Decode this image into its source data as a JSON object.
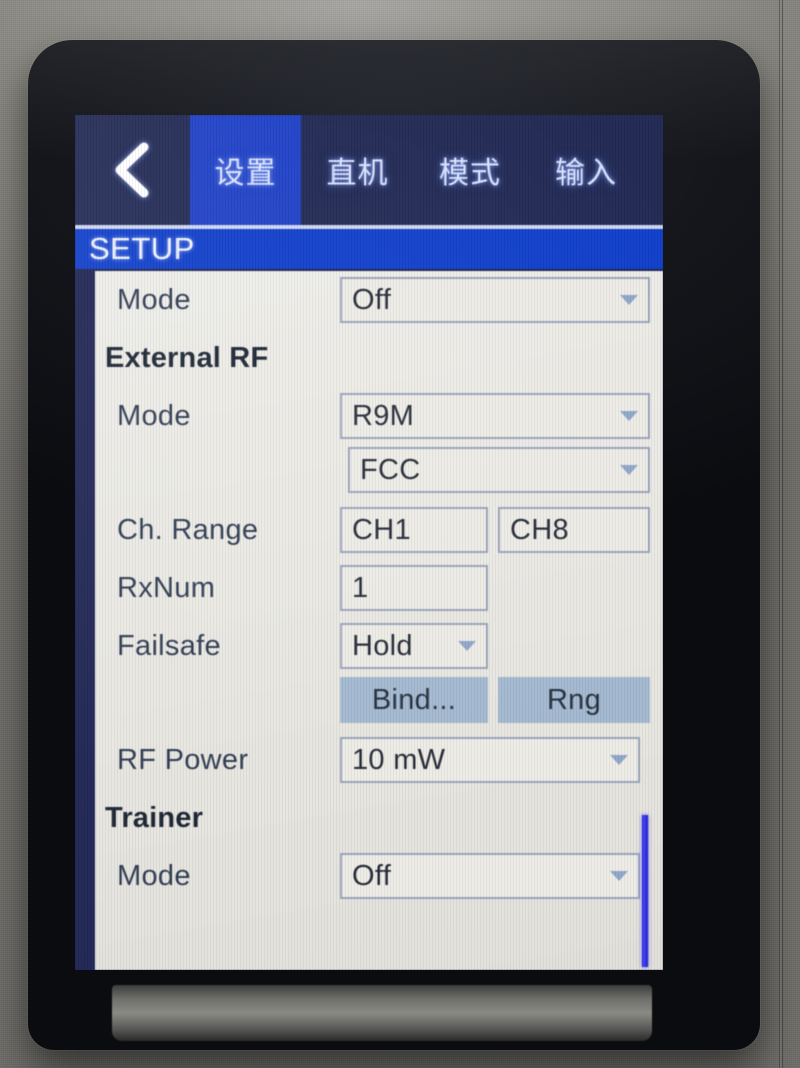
{
  "device": {
    "type": "rc-transmitter-lcd",
    "bezel_color": "#15171c",
    "background_color": "#87867f"
  },
  "screen": {
    "navbar": {
      "back_icon": "chevron-left-icon",
      "background_color": "#222a55",
      "active_tab_color": "#1f41c8",
      "tabs": [
        {
          "label": "设置",
          "active": true
        },
        {
          "label": "直机",
          "active": false
        },
        {
          "label": "模式",
          "active": false
        },
        {
          "label": "输入",
          "active": false
        }
      ]
    },
    "header": {
      "title": "SETUP",
      "background_color": "#0f3ecb",
      "text_color": "#f2f5ff"
    },
    "form": {
      "rows": [
        {
          "id": "internal-rf-mode",
          "label": "Mode",
          "type": "field",
          "section": false,
          "value": "Off",
          "dropdown": true
        },
        {
          "id": "external-rf-header",
          "label": "External RF",
          "type": "section",
          "section": true
        },
        {
          "id": "external-rf-mode",
          "label": "Mode",
          "type": "field",
          "section": false,
          "value": "R9M",
          "dropdown": true
        },
        {
          "id": "external-rf-region",
          "label": "",
          "type": "field",
          "section": false,
          "value": "FCC",
          "dropdown": true
        },
        {
          "id": "channel-range",
          "label": "Ch. Range",
          "type": "field-pair",
          "section": false,
          "value": "CH1",
          "value2": "CH8",
          "dropdown": false
        },
        {
          "id": "rx-num",
          "label": "RxNum",
          "type": "field",
          "section": false,
          "value": "1",
          "dropdown": false
        },
        {
          "id": "failsafe",
          "label": "Failsafe",
          "type": "field",
          "section": false,
          "value": "Hold",
          "dropdown": true
        },
        {
          "id": "bind-range-buttons",
          "label": "",
          "type": "buttons",
          "section": false,
          "value": "Bind...",
          "value2": "Rng"
        },
        {
          "id": "rf-power",
          "label": "RF Power",
          "type": "field",
          "section": false,
          "value": "10 mW",
          "dropdown": true
        },
        {
          "id": "trainer-header",
          "label": "Trainer",
          "type": "section",
          "section": true
        },
        {
          "id": "trainer-mode",
          "label": "Mode",
          "type": "field",
          "section": false,
          "value": "Off",
          "dropdown": true
        }
      ],
      "field_border_color": "#9aa4bd",
      "field_background_color": "#eeece6",
      "button_background_color": "#a3b9d0",
      "panel_background_color": "#efeeea",
      "label_color": "#2e3b52"
    },
    "scrollbar": {
      "color": "#3030e0",
      "position": "right",
      "thumb_top_fraction": 0.78,
      "thumb_height_fraction": 0.22
    }
  }
}
